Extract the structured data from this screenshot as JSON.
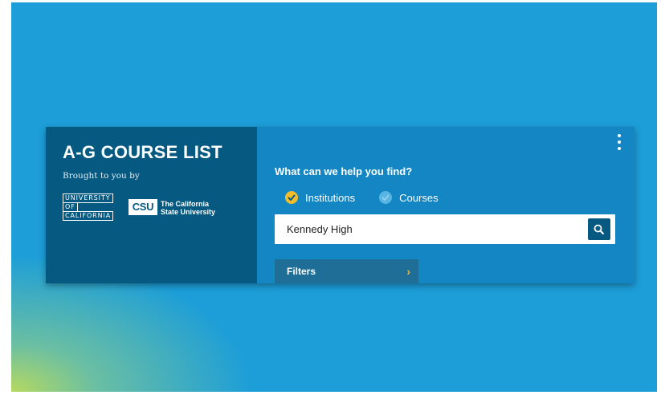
{
  "panel": {
    "title": "A-G COURSE LIST",
    "brought_by": "Brought to you by",
    "uc_logo": [
      "UNIVERSITY",
      "OF",
      "CALIFORNIA"
    ],
    "csu_logo": "CSU",
    "csu_name_line1": "The California",
    "csu_name_line2": "State University"
  },
  "search": {
    "question": "What can we help you find?",
    "options": [
      {
        "label": "Institutions",
        "selected": true
      },
      {
        "label": "Courses",
        "selected": false
      }
    ],
    "query": "Kennedy High",
    "filters_label": "Filters"
  },
  "colors": {
    "background": "#1d9ed8",
    "panel_dark": "#065a82",
    "panel_light": "#1486c3",
    "accent_yellow": "#f2bd2c"
  },
  "icons": {
    "menu": "kebab-menu-icon",
    "search": "magnifier-icon",
    "filters": "chevron-right-icon",
    "selected": "check-icon"
  }
}
